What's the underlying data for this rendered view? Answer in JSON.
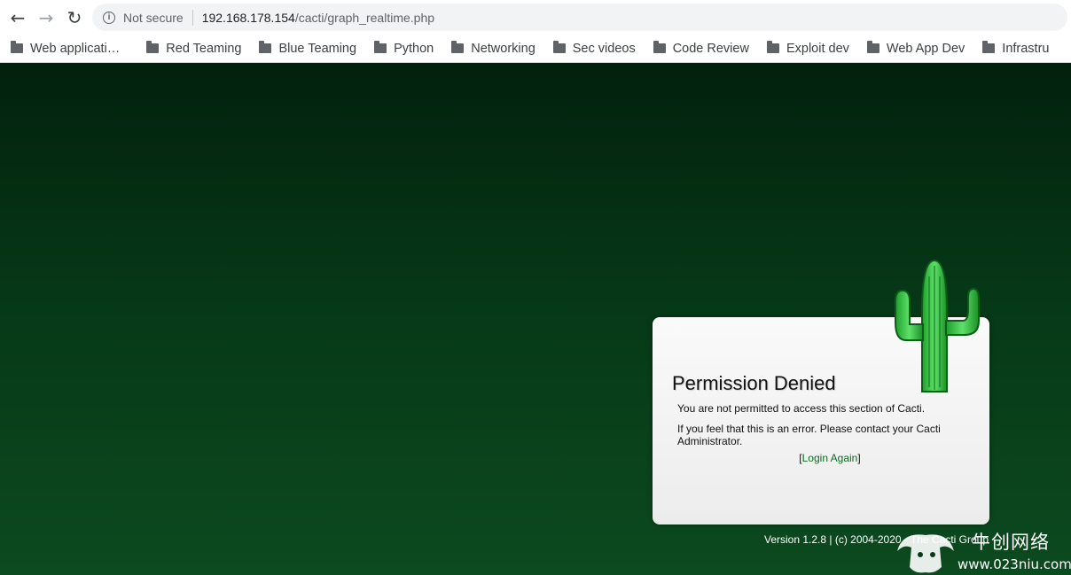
{
  "browser": {
    "security_label": "Not secure",
    "url_host": "192.168.178.154",
    "url_path": "/cacti/graph_realtime.php",
    "icons": [
      "back-icon",
      "forward-icon",
      "reload-icon",
      "info-icon"
    ],
    "bookmarks": [
      {
        "label": "Web applicati…"
      },
      {
        "label": "Red Teaming"
      },
      {
        "label": "Blue Teaming"
      },
      {
        "label": "Python"
      },
      {
        "label": "Networking"
      },
      {
        "label": "Sec videos"
      },
      {
        "label": "Code Review"
      },
      {
        "label": "Exploit dev"
      },
      {
        "label": "Web App Dev"
      },
      {
        "label": "Infrastru"
      }
    ]
  },
  "dialog": {
    "title": "Permission Denied",
    "message": "You are not permitted to access this section of Cacti.",
    "message2": "If you feel that this is an error. Please contact your Cacti Administrator.",
    "login_open": "[",
    "login_label": "Login Again",
    "login_close": "]"
  },
  "footer": {
    "version_text": "Version 1.2.8 | (c) 2004-2020 - The Cacti Group"
  },
  "watermark": {
    "brand_cn": "牛创网络",
    "url": "www.023niu.com"
  },
  "colors": {
    "page_bg_top": "#02210d",
    "page_bg_bottom": "#0c4a1f",
    "link": "#0a6b1f"
  }
}
